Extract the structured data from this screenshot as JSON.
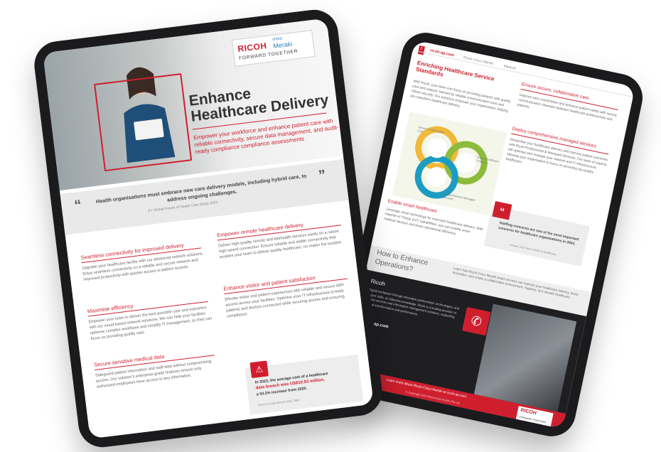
{
  "front": {
    "logo": {
      "brand": "RICOH",
      "partner_small": "cisco",
      "partner": "Meraki",
      "tagline": "FORWARD TOGETHER"
    },
    "title": "Enhance Healthcare Delivery",
    "subtitle": "Empower your workforce and enhance patient care with reliable connectivity, secure data management, and audit-ready compliance compliance assessments",
    "quote": {
      "open": "“",
      "close": "”",
      "text": "Health organisations must embrace new care delivery models, including hybrid care, to address ongoing challenges.",
      "source": "EY Global Future of Health Care Study 2023"
    },
    "sections": {
      "connectivity": {
        "heading": "Seamless connectivity for improved delivery",
        "body": "Upgrade your healthcare facility with our advanced network solutions. Enjoy seamless connectivity on a reliable and secure network and improved productivity with quicker access to patient records."
      },
      "efficiency": {
        "heading": "Maximise efficiency",
        "body": "Empower your team to deliver the best possible care and outcomes with our cloud-based network solutions. We can help your facilities optimise complex workflows and simplify IT management, so they can focus on providing quality care."
      },
      "secure_data": {
        "heading": "Secure sensitive medical data",
        "body": "Safeguard patient information and staff data without compromising access. Our solution’s enterprise-grade features ensure only authorised employees have access to key information."
      },
      "remote": {
        "heading": "Empower remote healthcare delivery",
        "body": "Deliver high-quality remote and telehealth services easily on a robust high-speed connection. Ensure reliable and stable connectivity that enables your team to deliver quality healthcare, no matter the location."
      },
      "visitor": {
        "heading": "Enhance visitor and patient satisfaction",
        "body": "Elevate visitor and patient experiences with reliable and secure WiFi access across your facilities. Optimise your IT infrastructure to keep patients and doctors connected while securing access and ensuring compliance."
      }
    },
    "stat": {
      "icon": "⚠",
      "line1": "In 2023, the average cost of a healthcare",
      "line2": "data breach was US$10.93 million,",
      "line3": "a 53.3% increase from 2020.",
      "source": "Cost of a Data Breach 2023, IBM"
    }
  },
  "back": {
    "header": {
      "page_no": "2",
      "site": "ricoh-ap.com",
      "partner": "Ricoh Cisco Meraki",
      "vertical": "Medical"
    },
    "enriching_title": "Enriching Healthcare Service Standards",
    "intro": "With Ricoh, your team can focus on providing patients with quality care and support, backed by reliable communication tools and robust security. Our solutions empower your organisation, helping you transform healthcare delivery.",
    "diagram_labels": {
      "a": "Secure Collaborative Care",
      "b": "Smart Healthcare Features",
      "c": "Comprehensive Managed Services"
    },
    "right": {
      "collab_heading": "Ensure secure, collaborative care",
      "collab_body": "Improve care coordination and enhance patient safety with secure communication channels between healthcare professionals and patients.",
      "managed_heading": "Deploy comprehensive managed services",
      "managed_body": "Streamline your healthcare delivery and improve patient outcomes with Ricoh Professional & Managed Services. Our team of experts will optimise and manage your network and IT infrastructure, allowing your organisation to focus on providing top-quality healthcare."
    },
    "quote": {
      "mark": "“",
      "text": "Staffing concerns are one of the most important concerns for healthcare organisations in 2024.",
      "source": "Lorman 2024 Tech Trends in Healthcare"
    },
    "smart": {
      "heading": "Enable smart healthcare",
      "body": "Leverage smart technology for improved healthcare delivery. With Internet of Things (IoT) capabilities, you can enable smart medical devices and boost operational efficiency."
    },
    "how": {
      "heading1": "How to Enhance",
      "heading2": "Operations?",
      "body": "Learn how Ricoh-Cisco Meraki smart services can improve your healthcare delivery, boost innovation, and create a collaborative environment. Together, let’s elevate healthcare."
    },
    "about": {
      "heading": "Ricoh",
      "body": "Digital workplace through innovative partnerships, technologies, and expert skills, at collective knowledge. Ricoh is a leading provider of digital services and information management solutions, supporting digital transformation and performance.",
      "site": "ricoh-ap.com",
      "phone_icon": "✆"
    },
    "footer": {
      "cta": "Learn more about Ricoh-Cisco Meraki at ricoh-ap.com",
      "copyright": "© Copyright 2024 Ricoh Asia Pacific Pte Ltd",
      "logo": "RICOH",
      "tagline": "FORWARD TOGETHER"
    }
  },
  "colors": {
    "accent": "#cf1f2e",
    "device": "#1b1b1d"
  }
}
